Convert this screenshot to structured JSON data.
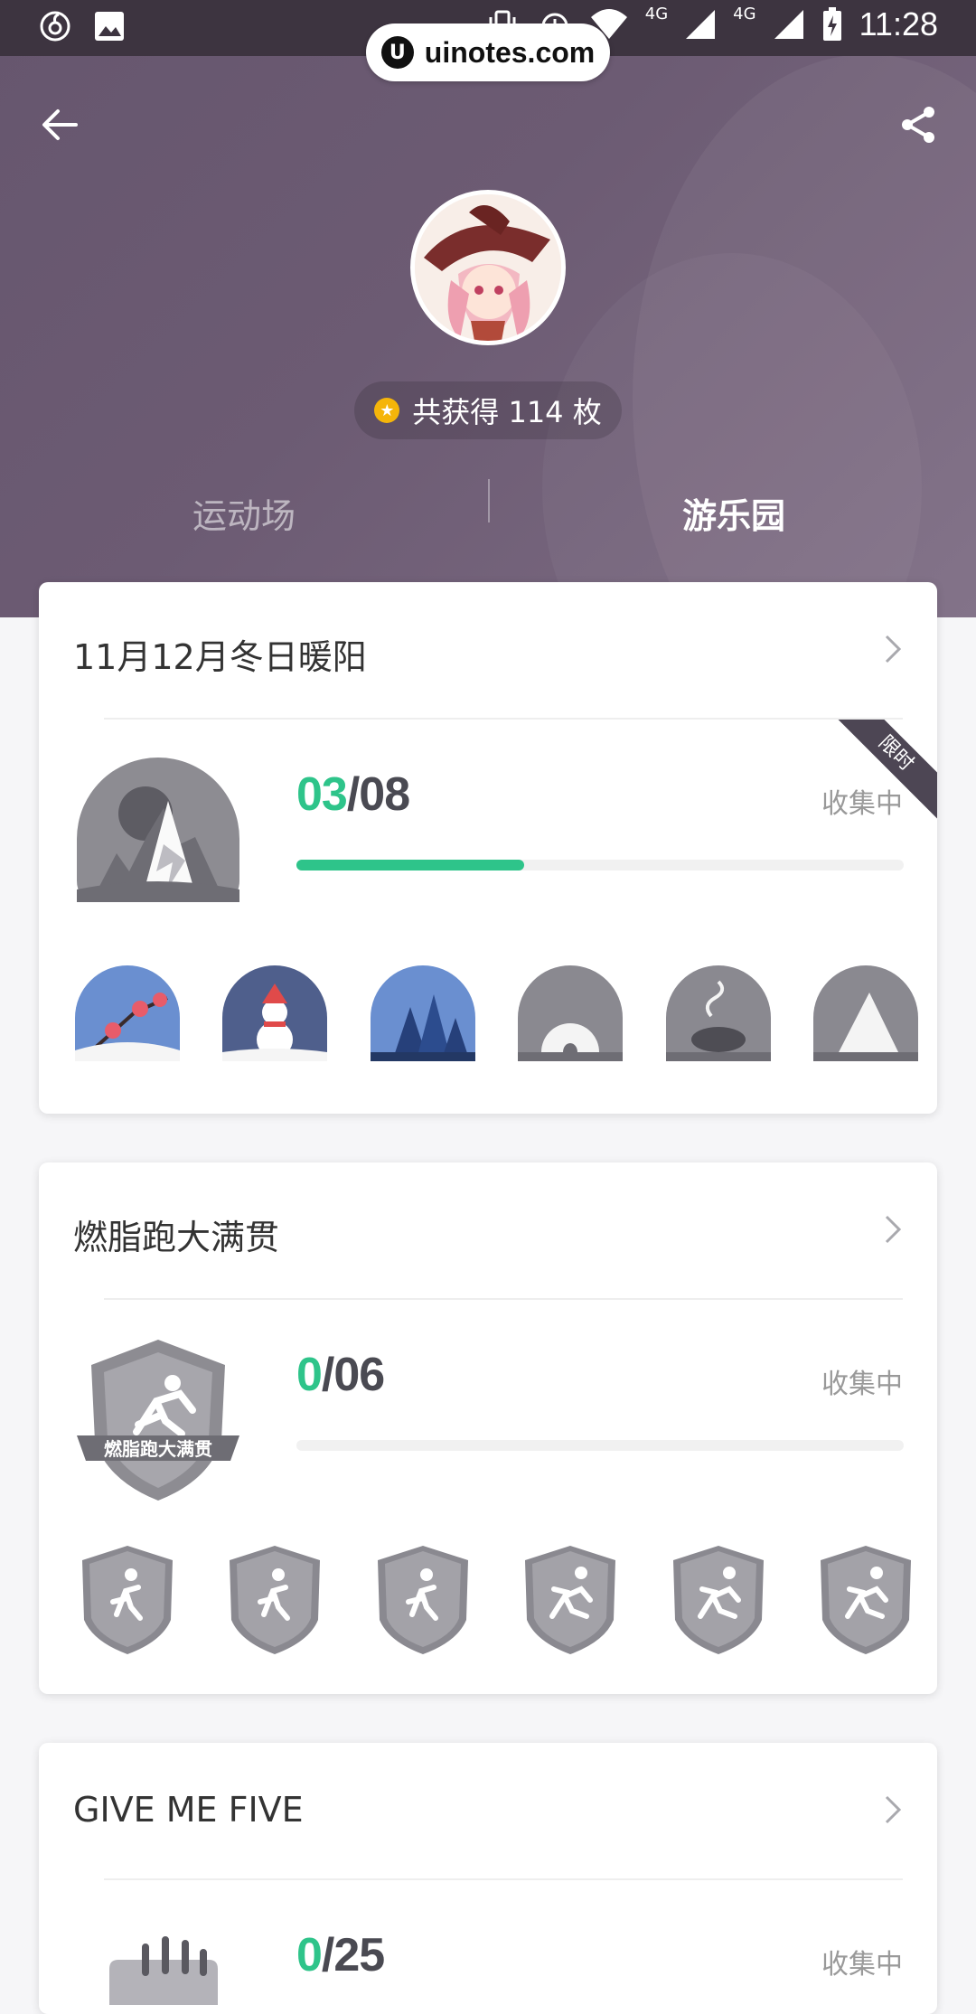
{
  "status_bar": {
    "time": "11:28",
    "network_a": "4G",
    "network_b": "4G"
  },
  "watermark": {
    "logo_letter": "U",
    "text": "uinotes.com"
  },
  "header": {
    "medal_count": "共获得 114 枚",
    "tabs": [
      {
        "label": "运动场"
      },
      {
        "label": "游乐园"
      }
    ],
    "active_tab": 1
  },
  "cards": [
    {
      "title": "11月12月冬日暖阳",
      "progress_done": "03",
      "progress_total": "/08",
      "progress_fraction": 0.375,
      "status": "收集中",
      "ribbon": "限时"
    },
    {
      "title": "燃脂跑大满贯",
      "progress_done": "0",
      "progress_total": "/06",
      "progress_fraction": 0,
      "status": "收集中",
      "badge_text": "燃脂跑大满贯"
    },
    {
      "title": "GIVE ME FIVE",
      "progress_done": "0",
      "progress_total": "/25",
      "progress_fraction": 0,
      "status": "收集中"
    }
  ],
  "colors": {
    "accent": "#2ec48a",
    "header_bg": "#6c5b73",
    "badge_gray": "#8a8990",
    "badge_blue": "#6a8fd0"
  }
}
